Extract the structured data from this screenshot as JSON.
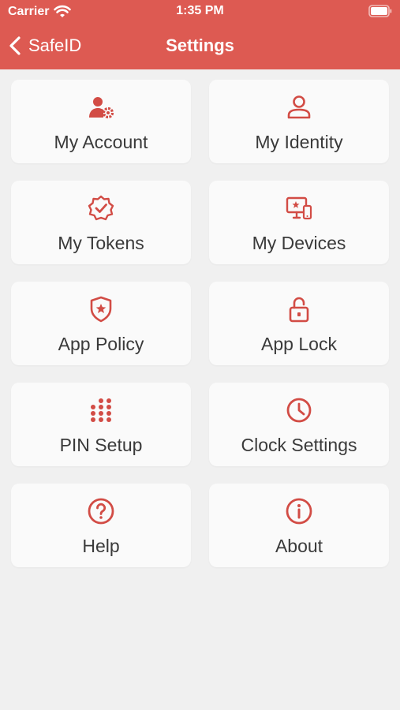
{
  "status_bar": {
    "carrier": "Carrier",
    "time": "1:35 PM"
  },
  "nav": {
    "back_label": "SafeID",
    "title": "Settings"
  },
  "colors": {
    "accent": "#dd5a52",
    "icon": "#d24c45",
    "background": "#f0f0f0",
    "card": "#fafafa"
  },
  "tiles": [
    {
      "label": "My Account",
      "icon": "user-gear-icon"
    },
    {
      "label": "My Identity",
      "icon": "user-icon"
    },
    {
      "label": "My Tokens",
      "icon": "badge-check-icon"
    },
    {
      "label": "My Devices",
      "icon": "devices-icon"
    },
    {
      "label": "App Policy",
      "icon": "shield-star-icon"
    },
    {
      "label": "App Lock",
      "icon": "padlock-open-icon"
    },
    {
      "label": "PIN Setup",
      "icon": "keypad-icon"
    },
    {
      "label": "Clock Settings",
      "icon": "clock-icon"
    },
    {
      "label": "Help",
      "icon": "question-icon"
    },
    {
      "label": "About",
      "icon": "info-icon"
    }
  ]
}
